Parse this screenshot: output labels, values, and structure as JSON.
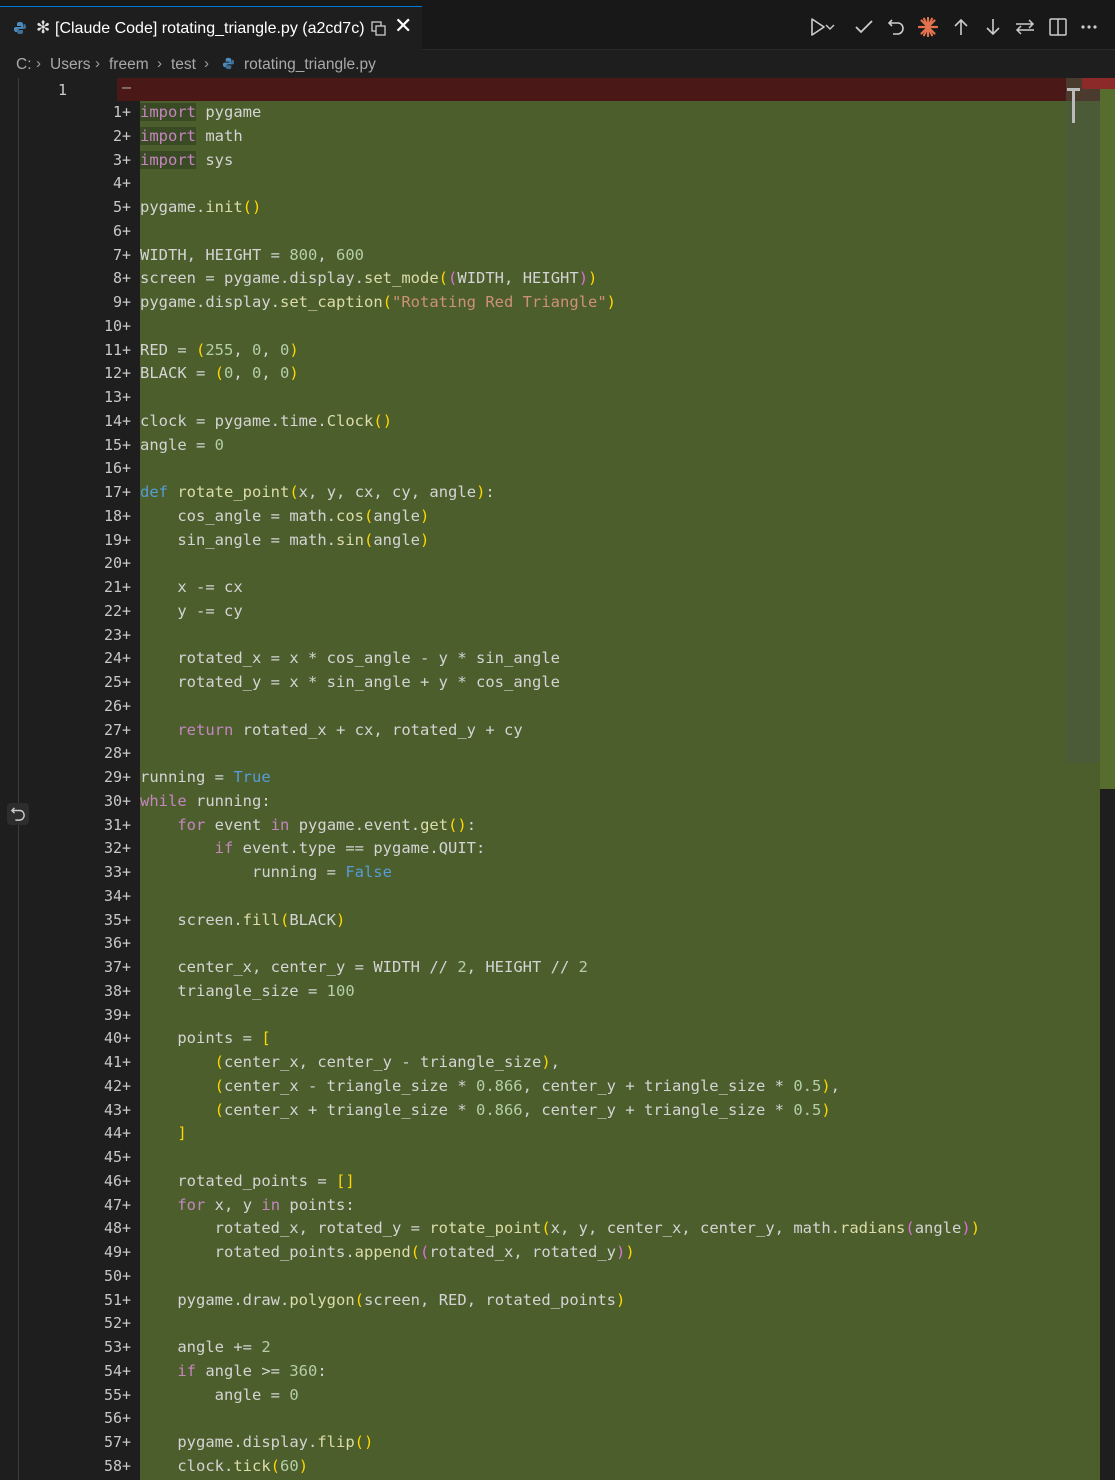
{
  "tab": {
    "star": "✻",
    "title": "[Claude Code] rotating_triangle.py (a2cd7c)",
    "close": "✕"
  },
  "breadcrumbs": [
    "C:",
    "Users",
    "freem",
    "test",
    "rotating_triangle.py"
  ],
  "toolbar_icons": [
    "run-icon",
    "chevron-down-icon",
    "accept-icon",
    "undo-icon",
    "claude-icon",
    "arrow-up-icon",
    "arrow-down-icon",
    "swap-icon",
    "split-editor-icon",
    "more-icon"
  ],
  "deleted_line": {
    "number": "1",
    "marker": "—"
  },
  "colors": {
    "inserted_bg": "#4b5e2c",
    "deleted_bg": "#4b1818",
    "accent": "#0078d4"
  },
  "lines": [
    "import pygame",
    "import math",
    "import sys",
    "",
    "pygame.init()",
    "",
    "WIDTH, HEIGHT = 800, 600",
    "screen = pygame.display.set_mode((WIDTH, HEIGHT))",
    "pygame.display.set_caption(\"Rotating Red Triangle\")",
    "",
    "RED = (255, 0, 0)",
    "BLACK = (0, 0, 0)",
    "",
    "clock = pygame.time.Clock()",
    "angle = 0",
    "",
    "def rotate_point(x, y, cx, cy, angle):",
    "    cos_angle = math.cos(angle)",
    "    sin_angle = math.sin(angle)",
    "",
    "    x -= cx",
    "    y -= cy",
    "",
    "    rotated_x = x * cos_angle - y * sin_angle",
    "    rotated_y = x * sin_angle + y * cos_angle",
    "",
    "    return rotated_x + cx, rotated_y + cy",
    "",
    "running = True",
    "while running:",
    "    for event in pygame.event.get():",
    "        if event.type == pygame.QUIT:",
    "            running = False",
    "",
    "    screen.fill(BLACK)",
    "",
    "    center_x, center_y = WIDTH // 2, HEIGHT // 2",
    "    triangle_size = 100",
    "",
    "    points = [",
    "        (center_x, center_y - triangle_size),",
    "        (center_x - triangle_size * 0.866, center_y + triangle_size * 0.5),",
    "        (center_x + triangle_size * 0.866, center_y + triangle_size * 0.5)",
    "    ]",
    "",
    "    rotated_points = []",
    "    for x, y in points:",
    "        rotated_x, rotated_y = rotate_point(x, y, center_x, center_y, math.radians(angle))",
    "        rotated_points.append((rotated_x, rotated_y))",
    "",
    "    pygame.draw.polygon(screen, RED, rotated_points)",
    "",
    "    angle += 2",
    "    if angle >= 360:",
    "        angle = 0",
    "",
    "    pygame.display.flip()",
    "    clock.tick(60)"
  ]
}
